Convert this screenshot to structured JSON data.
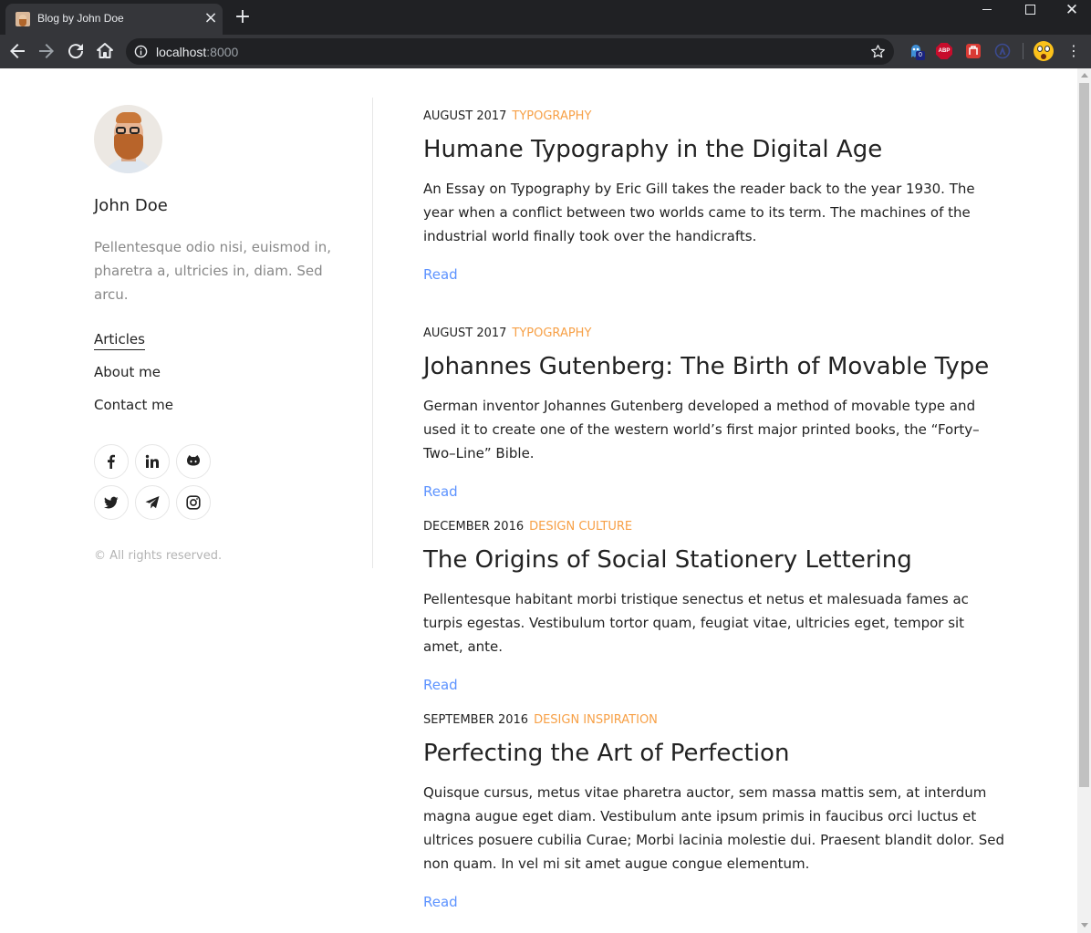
{
  "browser": {
    "tab_title": "Blog by John Doe",
    "url_host": "localhost",
    "url_port": ":8000",
    "extension_badge": "0",
    "abp_label": "ABP"
  },
  "sidebar": {
    "author_name": "John Doe",
    "bio": "Pellentesque odio nisi, euismod in, pharetra a, ultricies in, diam. Sed arcu.",
    "menu": [
      {
        "label": "Articles",
        "active": true
      },
      {
        "label": "About me",
        "active": false
      },
      {
        "label": "Contact me",
        "active": false
      }
    ],
    "social": [
      "facebook-icon",
      "linkedin-icon",
      "github-icon",
      "twitter-icon",
      "telegram-icon",
      "instagram-icon"
    ],
    "copyright": "© All rights reserved."
  },
  "posts": [
    {
      "date": "August 2017",
      "category": "Typography",
      "title": "Humane Typography in the Digital Age",
      "description": "An Essay on Typography by Eric Gill takes the reader back to the year 1930. The year when a conflict between two worlds came to its term. The machines of the industrial world finally took over the handicrafts.",
      "read_label": "Read"
    },
    {
      "date": "August 2017",
      "category": "Typography",
      "title": "Johannes Gutenberg: The Birth of Movable Type",
      "description": "German inventor Johannes Gutenberg developed a method of movable type and used it to create one of the western world’s first major printed books, the “Forty–Two–Line” Bible.",
      "read_label": "Read"
    },
    {
      "date": "December 2016",
      "category": "Design Culture",
      "title": "The Origins of Social Stationery Lettering",
      "description": "Pellentesque habitant morbi tristique senectus et netus et malesuada fames ac turpis egestas. Vestibulum tortor quam, feugiat vitae, ultricies eget, tempor sit amet, ante.",
      "read_label": "Read"
    },
    {
      "date": "September 2016",
      "category": "Design Inspiration",
      "title": "Perfecting the Art of Perfection",
      "description": "Quisque cursus, metus vitae pharetra auctor, sem massa mattis sem, at interdum magna augue eget diam. Vestibulum ante ipsum primis in faucibus orci luctus et ultrices posuere cubilia Curae; Morbi lacinia molestie dui. Praesent blandit dolor. Sed non quam. In vel mi sit amet augue congue elementum.",
      "read_label": "Read"
    }
  ],
  "colors": {
    "accent_link": "#5d93ff",
    "category": "#f7a046",
    "text": "#222222",
    "muted": "#888888"
  }
}
